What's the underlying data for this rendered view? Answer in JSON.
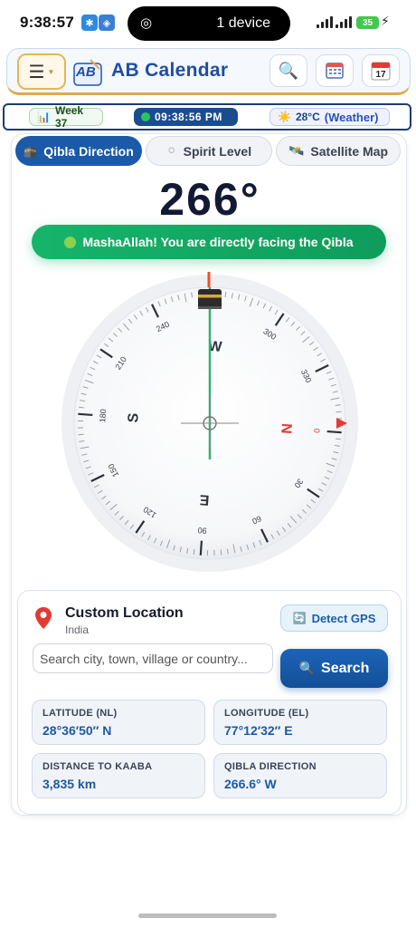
{
  "status": {
    "time": "9:38:57",
    "island_text": "1 device",
    "battery": "35"
  },
  "header": {
    "title": "AB Calendar",
    "calendar_day": "17"
  },
  "info": {
    "week": "Week 37",
    "clock": "09:38:56 PM",
    "temperature": "28°C",
    "weather_label": "(Weather)"
  },
  "tabs": [
    {
      "label": "Qibla Direction",
      "active": true
    },
    {
      "label": "Spirit Level",
      "active": false
    },
    {
      "label": "Satellite Map",
      "active": false
    }
  ],
  "qibla": {
    "degree": "266°",
    "heading": 266,
    "banner": "MashaAllah! You are directly facing the Qibla"
  },
  "compass": {
    "cardinals": {
      "N": "N",
      "E": "E",
      "S": "S",
      "W": "W"
    },
    "tick_labels": [
      "0",
      "30",
      "60",
      "90",
      "120",
      "150",
      "180",
      "210",
      "240",
      "300",
      "330"
    ]
  },
  "location": {
    "title": "Custom Location",
    "country": "India",
    "detect_label": "Detect GPS",
    "search_placeholder": "Search city, town, village or country...",
    "search_label": "Search",
    "stats": [
      {
        "label": "LATITUDE (NL)",
        "value": "28°36′50″ N"
      },
      {
        "label": "LONGITUDE (EL)",
        "value": "77°12′32″ E"
      },
      {
        "label": "DISTANCE TO KAABA",
        "value": "3,835 km"
      },
      {
        "label": "QIBLA DIRECTION",
        "value": "266.6° W"
      }
    ]
  },
  "colors": {
    "primary": "#1a5aa8",
    "success": "#16b46b",
    "north": "#e53935",
    "accent_gold": "#e0a94e"
  }
}
